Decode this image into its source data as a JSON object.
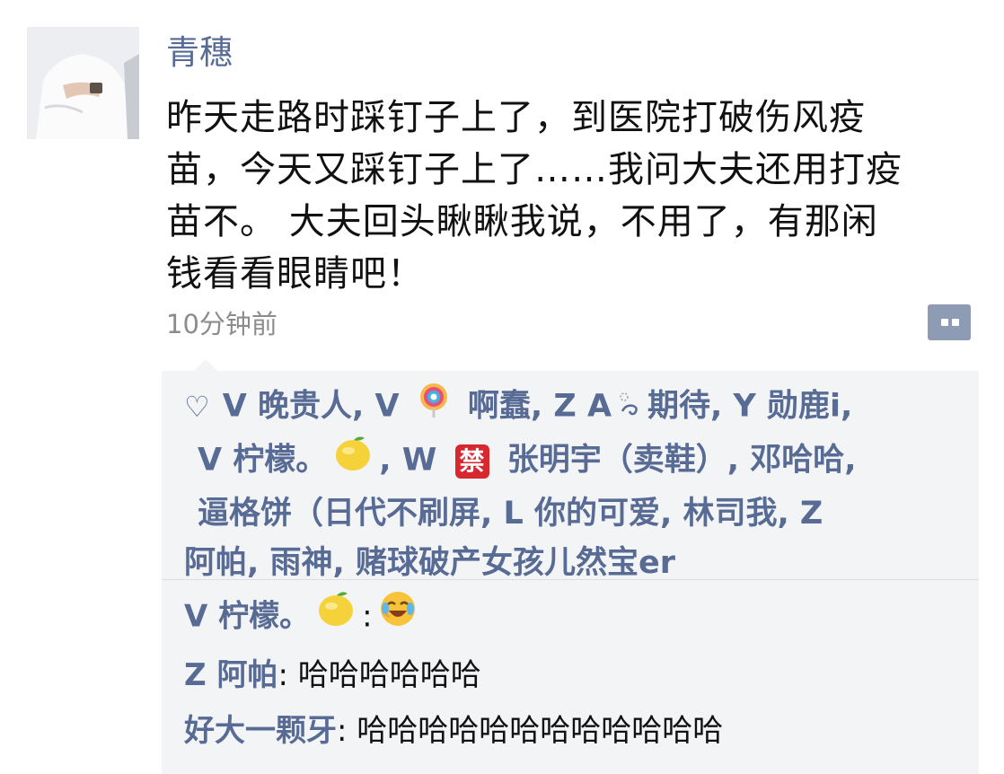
{
  "post": {
    "username": "青穗",
    "text_lines": [
      "昨天走路时踩钉子上了，到医院打破伤风疫",
      "苗，今天又踩钉子上了……我问大夫还用打疫",
      "苗不。 大夫回头瞅瞅我说，不用了，有那闲",
      "钱看看眼睛吧！"
    ],
    "timestamp": "10分钟前",
    "avatar": {
      "icon": "avatar-photo"
    },
    "more_button": {
      "icon": "more-dots-icon"
    }
  },
  "likes": {
    "icon": "heart-outline-icon",
    "heart_glyph": "♡",
    "segments": [
      {
        "text": "V 晚贵人, V "
      },
      {
        "emoji": "lollipop-icon"
      },
      {
        "text": " 啊蠢, Z A"
      },
      {
        "emoji": "swirl-icon"
      },
      {
        "text": "期待, Y 勋鹿i,"
      },
      {
        "text": "V 柠檬。"
      },
      {
        "emoji": "lemon-icon"
      },
      {
        "text": ", W "
      },
      {
        "emoji": "forbidden-badge-icon",
        "label": "禁"
      },
      {
        "text": " 张明宇（卖鞋）, 邓哈哈,"
      },
      {
        "text": "逼格饼（日代不刷屏, L 你的可爱, 林司我, Z"
      },
      {
        "text": "阿帕, 雨神, 赌球破产女孩儿然宝er"
      }
    ]
  },
  "comments": [
    {
      "name": "V 柠檬。",
      "emoji_after_name": "lemon-icon",
      "separator": ":",
      "emoji_content": "laughing-crying-icon",
      "text": ""
    },
    {
      "name": "Z 阿帕",
      "separator": ":",
      "text": " 哈哈哈哈哈哈"
    },
    {
      "name": "好大一颗牙",
      "separator": ":",
      "text": " 哈哈哈哈哈哈哈哈哈哈哈哈"
    }
  ],
  "colors": {
    "link_blue": "#576b95",
    "text": "#111111",
    "time_gray": "#8c8c8c",
    "panel_bg": "#f3f4f6",
    "more_button_bg": "#8e9bb5"
  }
}
